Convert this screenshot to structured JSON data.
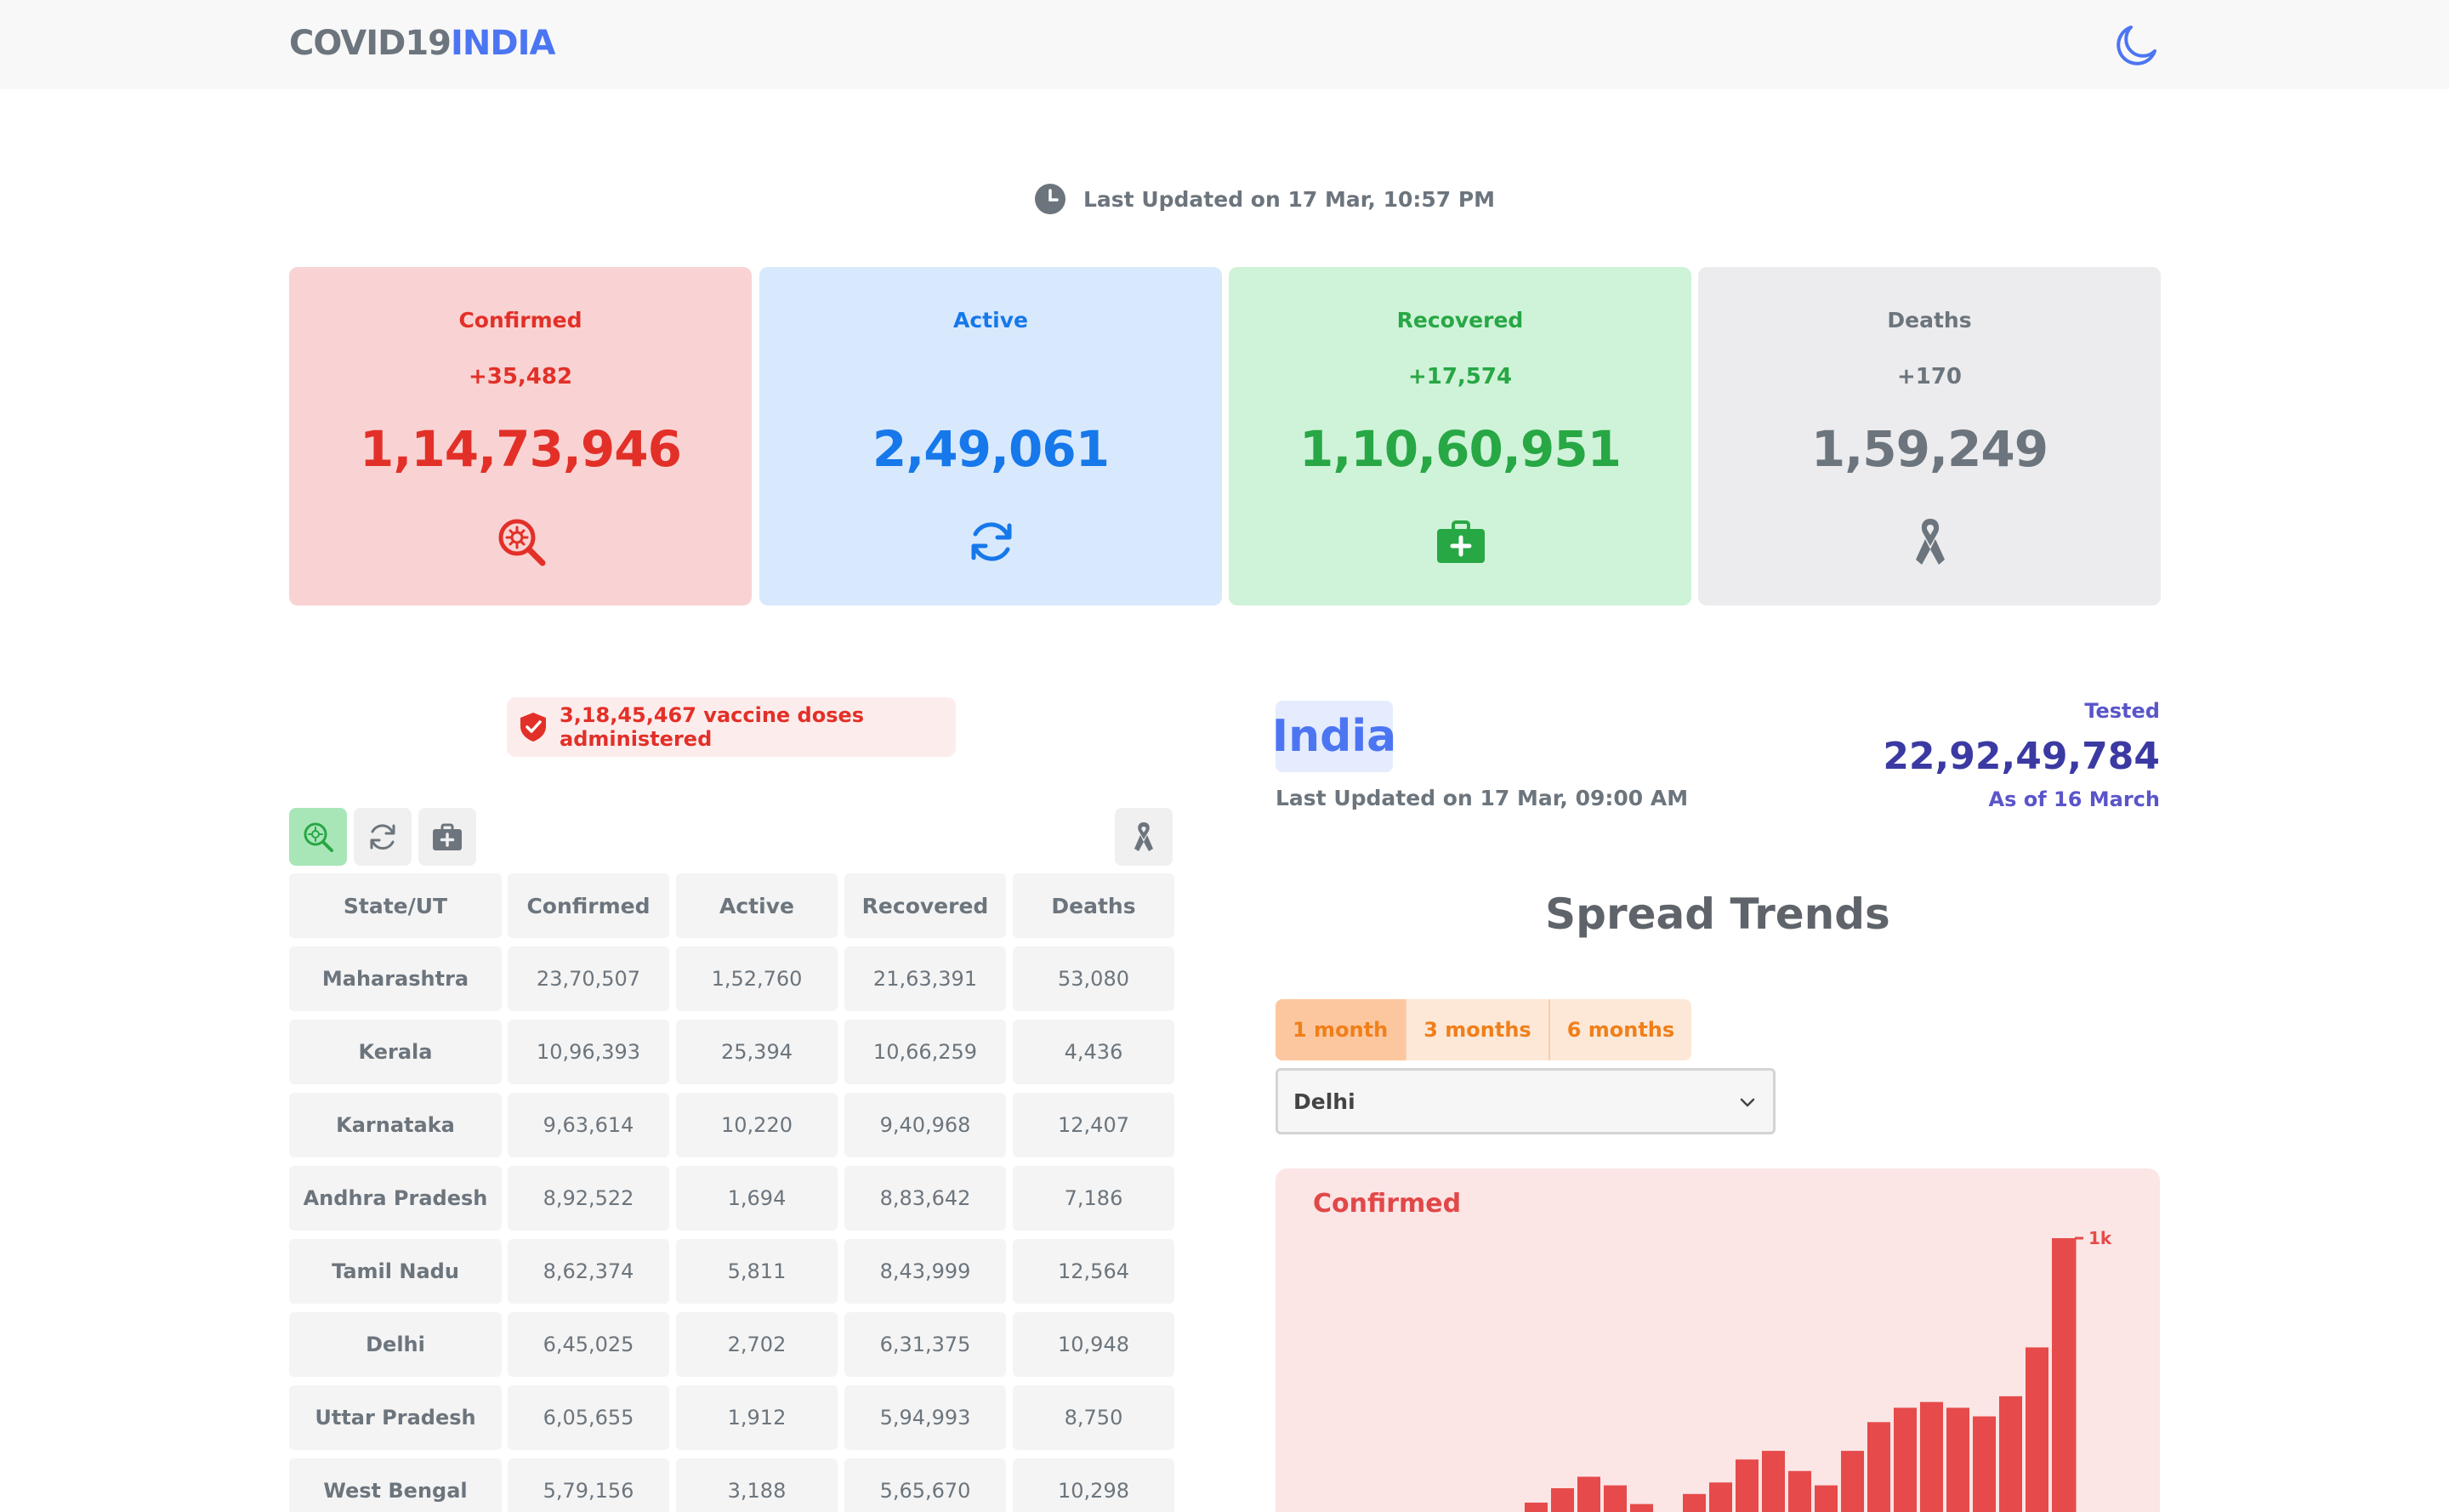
{
  "header": {
    "brand_part1": "COVID19",
    "brand_part2": "INDIA",
    "theme_icon": "moon-icon",
    "accent_color": "#4c75f2"
  },
  "last_updated": "Last Updated on 17 Mar, 10:57 PM",
  "cards": {
    "confirmed": {
      "title": "Confirmed",
      "delta": "+35,482",
      "total": "1,14,73,946",
      "icon": "virus-search-icon",
      "color": "#e23028"
    },
    "active": {
      "title": "Active",
      "delta": "",
      "total": "2,49,061",
      "icon": "refresh-icon",
      "color": "#1678ea"
    },
    "recovered": {
      "title": "Recovered",
      "delta": "+17,574",
      "total": "1,10,60,951",
      "icon": "medkit-icon",
      "color": "#28a745"
    },
    "deaths": {
      "title": "Deaths",
      "delta": "+170",
      "total": "1,59,249",
      "icon": "ribbon-icon",
      "color": "#6c757d"
    }
  },
  "vaccine": {
    "text": "3,18,45,467 vaccine doses administered",
    "icon": "shield-check-icon"
  },
  "table": {
    "toggle_buttons": [
      "virus-search-icon",
      "refresh-icon",
      "medkit-icon",
      "ribbon-icon"
    ],
    "headers": [
      "State/UT",
      "Confirmed",
      "Active",
      "Recovered",
      "Deaths"
    ],
    "rows": [
      [
        "Maharashtra",
        "23,70,507",
        "1,52,760",
        "21,63,391",
        "53,080"
      ],
      [
        "Kerala",
        "10,96,393",
        "25,394",
        "10,66,259",
        "4,436"
      ],
      [
        "Karnataka",
        "9,63,614",
        "10,220",
        "9,40,968",
        "12,407"
      ],
      [
        "Andhra Pradesh",
        "8,92,522",
        "1,694",
        "8,83,642",
        "7,186"
      ],
      [
        "Tamil Nadu",
        "8,62,374",
        "5,811",
        "8,43,999",
        "12,564"
      ],
      [
        "Delhi",
        "6,45,025",
        "2,702",
        "6,31,375",
        "10,948"
      ],
      [
        "Uttar Pradesh",
        "6,05,655",
        "1,912",
        "5,94,993",
        "8,750"
      ],
      [
        "West Bengal",
        "5,79,156",
        "3,188",
        "5,65,670",
        "10,298"
      ]
    ]
  },
  "country": {
    "name": "India",
    "last_updated": "Last Updated on 17 Mar, 09:00 AM",
    "tested_label": "Tested",
    "tested_value": "22,92,49,784",
    "tested_asof": "As of 16 March"
  },
  "trends": {
    "title": "Spread Trends",
    "ranges": [
      "1 month",
      "3 months",
      "6 months"
    ],
    "selected_range": "1 month",
    "selected_state": "Delhi",
    "dropdown_icon": "chevron-down-icon"
  },
  "chart_data": {
    "type": "bar",
    "title": "Confirmed",
    "y_tick_label": "1k",
    "ylim": [
      0,
      1000
    ],
    "color": "#e64a4a",
    "values": [
      0,
      0,
      0,
      0,
      20,
      12,
      6,
      0,
      0,
      80,
      130,
      170,
      140,
      75,
      45,
      110,
      150,
      230,
      260,
      190,
      140,
      260,
      360,
      410,
      430,
      410,
      380,
      450,
      620,
      1000
    ]
  }
}
